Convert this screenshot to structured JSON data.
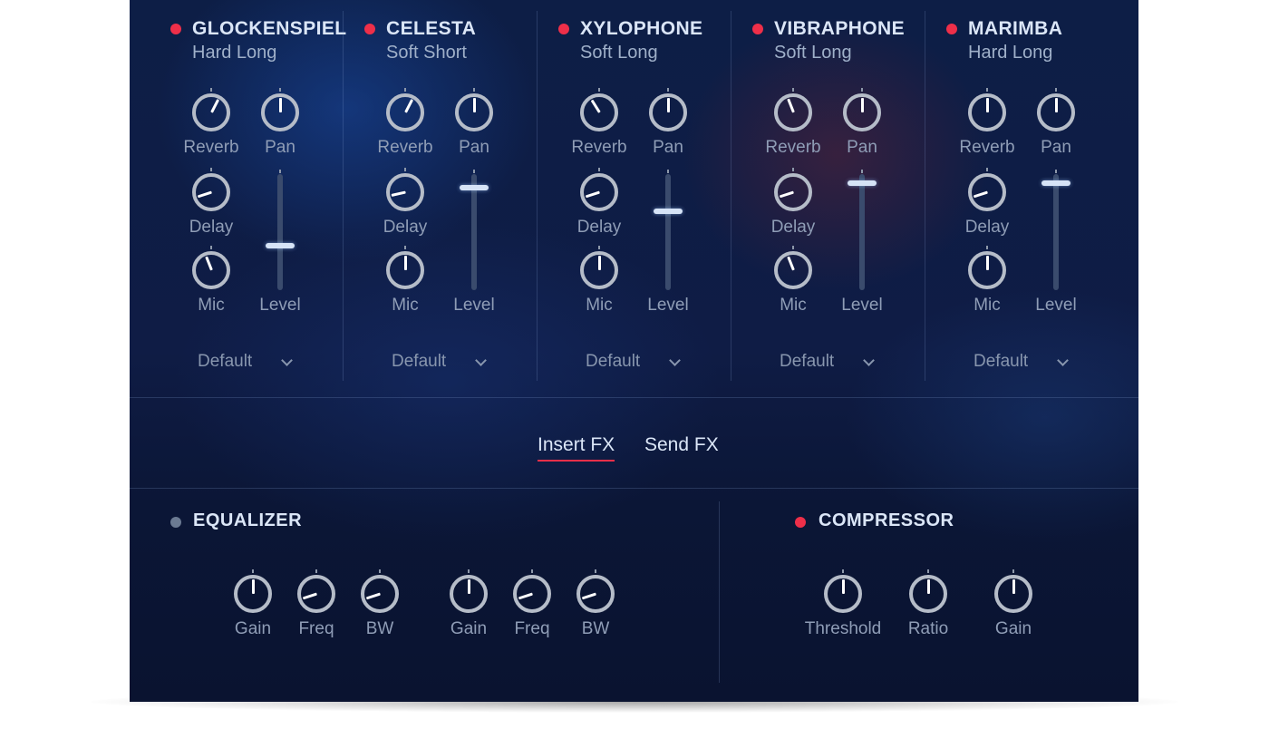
{
  "channels": [
    {
      "name": "GLOCKENSPIEL",
      "preset_name": "Hard Long",
      "active": true,
      "knobs": {
        "reverb": {
          "label": "Reverb",
          "value": 0.6
        },
        "pan": {
          "label": "Pan",
          "value": 0.5
        },
        "delay": {
          "label": "Delay",
          "value": 0.1
        },
        "mic": {
          "label": "Mic",
          "value": 0.42
        }
      },
      "fader": {
        "label": "Level",
        "value": 0.38
      },
      "dropdown": {
        "label": "Default"
      }
    },
    {
      "name": "CELESTA",
      "preset_name": "Soft Short",
      "active": true,
      "knobs": {
        "reverb": {
          "label": "Reverb",
          "value": 0.6
        },
        "pan": {
          "label": "Pan",
          "value": 0.5
        },
        "delay": {
          "label": "Delay",
          "value": 0.12
        },
        "mic": {
          "label": "Mic",
          "value": 0.5
        }
      },
      "fader": {
        "label": "Level",
        "value": 0.88
      },
      "dropdown": {
        "label": "Default"
      }
    },
    {
      "name": "XYLOPHONE",
      "preset_name": "Soft Long",
      "active": true,
      "knobs": {
        "reverb": {
          "label": "Reverb",
          "value": 0.38
        },
        "pan": {
          "label": "Pan",
          "value": 0.5
        },
        "delay": {
          "label": "Delay",
          "value": 0.1
        },
        "mic": {
          "label": "Mic",
          "value": 0.5
        }
      },
      "fader": {
        "label": "Level",
        "value": 0.68
      },
      "dropdown": {
        "label": "Default"
      }
    },
    {
      "name": "VIBRAPHONE",
      "preset_name": "Soft Long",
      "active": true,
      "knobs": {
        "reverb": {
          "label": "Reverb",
          "value": 0.42
        },
        "pan": {
          "label": "Pan",
          "value": 0.5
        },
        "delay": {
          "label": "Delay",
          "value": 0.1
        },
        "mic": {
          "label": "Mic",
          "value": 0.42
        }
      },
      "fader": {
        "label": "Level",
        "value": 0.92
      },
      "dropdown": {
        "label": "Default"
      }
    },
    {
      "name": "MARIMBA",
      "preset_name": "Hard Long",
      "active": true,
      "knobs": {
        "reverb": {
          "label": "Reverb",
          "value": 0.5
        },
        "pan": {
          "label": "Pan",
          "value": 0.5
        },
        "delay": {
          "label": "Delay",
          "value": 0.1
        },
        "mic": {
          "label": "Mic",
          "value": 0.5
        }
      },
      "fader": {
        "label": "Level",
        "value": 0.92
      },
      "dropdown": {
        "label": "Default"
      }
    }
  ],
  "fx_tabs": {
    "insert": "Insert FX",
    "send": "Send FX",
    "active": "insert"
  },
  "equalizer": {
    "title": "EQUALIZER",
    "active": false,
    "bands": [
      {
        "gain": {
          "label": "Gain",
          "value": 0.5
        },
        "freq": {
          "label": "Freq",
          "value": 0.1
        },
        "bw": {
          "label": "BW",
          "value": 0.1
        }
      },
      {
        "gain": {
          "label": "Gain",
          "value": 0.5
        },
        "freq": {
          "label": "Freq",
          "value": 0.1
        },
        "bw": {
          "label": "BW",
          "value": 0.1
        }
      }
    ]
  },
  "compressor": {
    "title": "COMPRESSOR",
    "active": true,
    "knobs": {
      "threshold": {
        "label": "Threshold",
        "value": 0.5
      },
      "ratio": {
        "label": "Ratio",
        "value": 0.5
      },
      "gain": {
        "label": "Gain",
        "value": 0.5
      }
    }
  },
  "colors": {
    "accent": "#ee2f49",
    "indicator_off": "#6b7a92",
    "text_primary": "#dbe6f7",
    "text_secondary": "#9fb0c9",
    "label": "#8f9db6",
    "knob_ring": "#b5bcc8",
    "fader_track": "#3a4b6d"
  },
  "icons": {
    "active_indicator": "led-dot-icon",
    "dropdown": "chevron-down-icon"
  }
}
